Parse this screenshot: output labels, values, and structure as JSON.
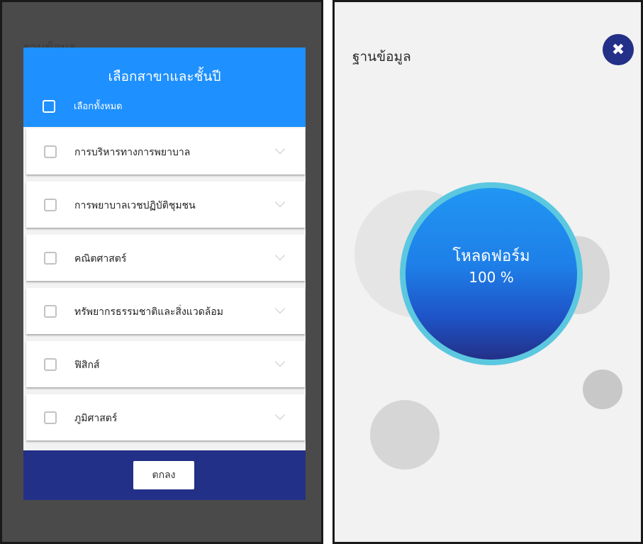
{
  "left": {
    "bg_title": "ฐานข้อมูล",
    "dialog": {
      "title": "เลือกสาขาและชั้นปี",
      "select_all_label": "เลือกทั้งหมด",
      "items": [
        {
          "label": "การบริหารทางการพยาบาล"
        },
        {
          "label": "การพยาบาลเวชปฏิบัติชุมชน"
        },
        {
          "label": "คณิตศาสตร์"
        },
        {
          "label": "ทรัพยากรธรรมชาติและสิ่งแวดล้อม"
        },
        {
          "label": "ฟิสิกส์"
        },
        {
          "label": "ภูมิศาสตร์"
        }
      ],
      "ok_label": "ตกลง"
    }
  },
  "right": {
    "title": "ฐานข้อมูล",
    "close_icon": "✖",
    "progress_text": "โหลดฟอร์ม",
    "progress_value": "100 %",
    "progress_fraction": 1.0
  },
  "colors": {
    "header_blue": "#1e90ff",
    "footer_navy": "#233087",
    "ring_cyan": "#5bc8e0"
  }
}
